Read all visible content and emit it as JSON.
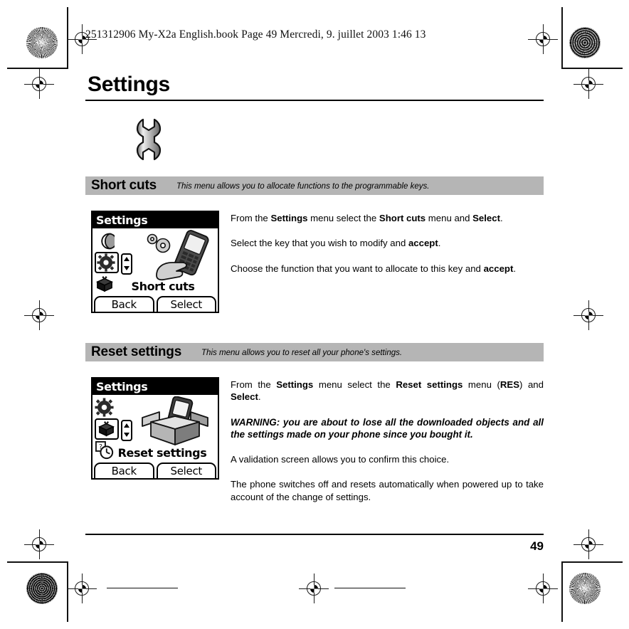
{
  "document": {
    "header_line": "251312906 My-X2a English.book  Page 49  Mercredi, 9. juillet 2003  1:46 13",
    "chapter_title": "Settings",
    "chapter_icon": "wrench-icon",
    "page_number": "49"
  },
  "sections": [
    {
      "title": "Short cuts",
      "description": "This menu allows you to allocate functions to the programmable keys.",
      "screenshot": {
        "title": "Settings",
        "caption": "Short cuts",
        "hero_icon": "hand-holding-phone-with-gears-illustration",
        "rail_icons": [
          "moon-icon",
          "gear-icon",
          "gift-box-icon"
        ],
        "selected_icon": "gear-icon",
        "softkey_left": "Back",
        "softkey_right": "Select"
      },
      "paragraphs": [
        {
          "style": "normal",
          "runs": [
            {
              "t": "From the ",
              "b": false
            },
            {
              "t": "Settings",
              "b": true
            },
            {
              "t": " menu select the ",
              "b": false
            },
            {
              "t": "Short cuts",
              "b": true
            },
            {
              "t": " menu and ",
              "b": false
            },
            {
              "t": "Select",
              "b": true
            },
            {
              "t": ".",
              "b": false
            }
          ]
        },
        {
          "style": "normal",
          "runs": [
            {
              "t": "Select the key that you wish to modify and ",
              "b": false
            },
            {
              "t": "accept",
              "b": true
            },
            {
              "t": ".",
              "b": false
            }
          ]
        },
        {
          "style": "normal",
          "runs": [
            {
              "t": "Choose the function that you want to allocate to this key and ",
              "b": false
            },
            {
              "t": "accept",
              "b": true
            },
            {
              "t": ".",
              "b": false
            }
          ]
        }
      ]
    },
    {
      "title": "Reset settings",
      "description": "This menu allows you to reset all your phone's settings.",
      "screenshot": {
        "title": "Settings",
        "caption": "Reset settings",
        "hero_icon": "phone-in-open-box-illustration",
        "rail_icons": [
          "gear-icon",
          "gift-box-icon",
          "clock-icon"
        ],
        "selected_icon": "gift-box-icon",
        "softkey_left": "Back",
        "softkey_right": "Select"
      },
      "paragraphs": [
        {
          "style": "normal",
          "runs": [
            {
              "t": "From the ",
              "b": false
            },
            {
              "t": "Settings",
              "b": true
            },
            {
              "t": " menu select the ",
              "b": false
            },
            {
              "t": "Reset settings",
              "b": true
            },
            {
              "t": " menu (",
              "b": false
            },
            {
              "t": "RES",
              "b": true
            },
            {
              "t": ") and ",
              "b": false
            },
            {
              "t": "Select",
              "b": true
            },
            {
              "t": ".",
              "b": false
            }
          ]
        },
        {
          "style": "warn",
          "runs": [
            {
              "t": "WARNING:  you are about to lose all the downloaded objects and all the settings made on your phone since you bought it.",
              "b": false
            }
          ]
        },
        {
          "style": "normal",
          "runs": [
            {
              "t": "A validation screen allows you to confirm this choice.",
              "b": false
            }
          ]
        },
        {
          "style": "normal",
          "runs": [
            {
              "t": "The phone switches off and resets automatically when powered up to take account of the change of settings.",
              "b": false
            }
          ]
        }
      ]
    }
  ],
  "colors": {
    "section_bar": "#b5b5b5",
    "ink": "#000000",
    "paper": "#ffffff"
  }
}
